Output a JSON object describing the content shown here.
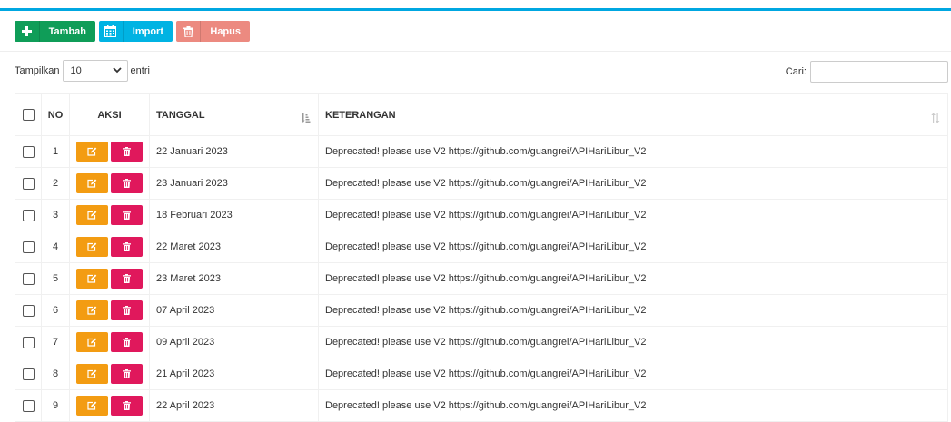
{
  "toolbar": {
    "tambah_label": "Tambah",
    "import_label": "Import",
    "hapus_label": "Hapus",
    "colors": {
      "tambah": "#0f9d58",
      "import": "#00b3e3",
      "hapus": "#ec8a80",
      "accent": "#00a7e1"
    }
  },
  "length": {
    "prefix": "Tampilkan",
    "value": "10",
    "suffix": "entri"
  },
  "search": {
    "label": "Cari:",
    "value": ""
  },
  "table": {
    "headers": {
      "no": "NO",
      "aksi": "AKSI",
      "tanggal": "TANGGAL",
      "keterangan": "KETERANGAN"
    },
    "rows": [
      {
        "no": "1",
        "tanggal": "22 Januari 2023",
        "keterangan": "Deprecated! please use V2 https://github.com/guangrei/APIHariLibur_V2"
      },
      {
        "no": "2",
        "tanggal": "23 Januari 2023",
        "keterangan": "Deprecated! please use V2 https://github.com/guangrei/APIHariLibur_V2"
      },
      {
        "no": "3",
        "tanggal": "18 Februari 2023",
        "keterangan": "Deprecated! please use V2 https://github.com/guangrei/APIHariLibur_V2"
      },
      {
        "no": "4",
        "tanggal": "22 Maret 2023",
        "keterangan": "Deprecated! please use V2 https://github.com/guangrei/APIHariLibur_V2"
      },
      {
        "no": "5",
        "tanggal": "23 Maret 2023",
        "keterangan": "Deprecated! please use V2 https://github.com/guangrei/APIHariLibur_V2"
      },
      {
        "no": "6",
        "tanggal": "07 April 2023",
        "keterangan": "Deprecated! please use V2 https://github.com/guangrei/APIHariLibur_V2"
      },
      {
        "no": "7",
        "tanggal": "09 April 2023",
        "keterangan": "Deprecated! please use V2 https://github.com/guangrei/APIHariLibur_V2"
      },
      {
        "no": "8",
        "tanggal": "21 April 2023",
        "keterangan": "Deprecated! please use V2 https://github.com/guangrei/APIHariLibur_V2"
      },
      {
        "no": "9",
        "tanggal": "22 April 2023",
        "keterangan": "Deprecated! please use V2 https://github.com/guangrei/APIHariLibur_V2"
      }
    ]
  },
  "icons": {
    "tambah": "plus-icon",
    "import": "calendar-icon",
    "hapus": "trash-icon",
    "edit": "edit-icon",
    "delete": "trash-icon",
    "sort_tanggal": "sort-amount-asc-icon",
    "sort_keterangan": "sort-icon"
  }
}
